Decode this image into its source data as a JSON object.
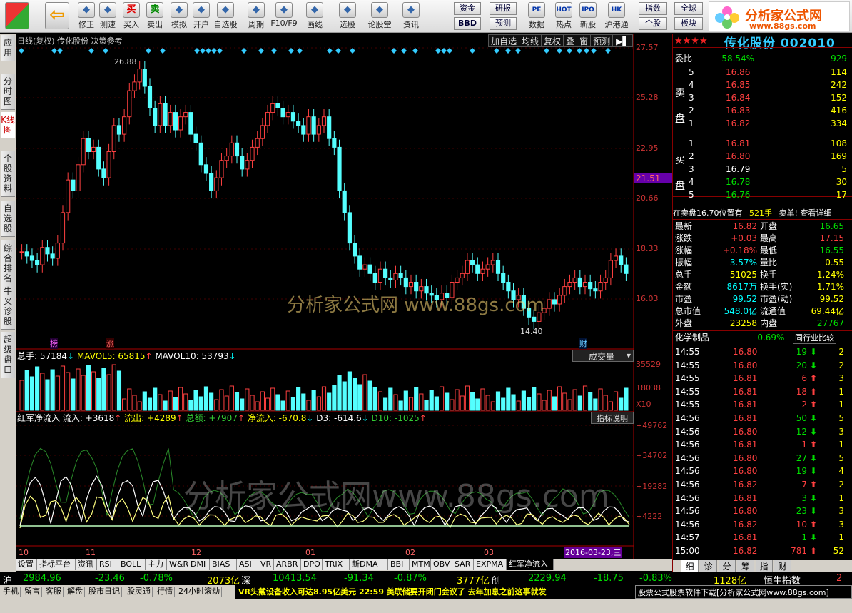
{
  "toolbar": {
    "items": [
      {
        "label": "",
        "icon": "app-icon"
      },
      {
        "label": "",
        "icon": "back-arrow-icon"
      },
      {
        "label": "修正",
        "icon": "up-icon"
      },
      {
        "label": "测速",
        "icon": "clock-icon"
      },
      {
        "label": "买入",
        "icon": "buy-icon",
        "glyph": "买"
      },
      {
        "label": "卖出",
        "icon": "sell-icon",
        "glyph": "卖"
      },
      {
        "label": "模拟",
        "icon": "hammer-icon"
      },
      {
        "label": "开户",
        "icon": "lock-icon"
      },
      {
        "label": "自选股",
        "icon": "star-icon"
      },
      {
        "label": "周期",
        "icon": "cycle-icon"
      },
      {
        "label": "F10/F9",
        "icon": "f10-icon"
      },
      {
        "label": "画线",
        "icon": "pencil-icon"
      },
      {
        "label": "选股",
        "icon": "screen-icon"
      },
      {
        "label": "论股堂",
        "icon": "forum-icon"
      },
      {
        "label": "资讯",
        "icon": "news-icon"
      }
    ],
    "group_buttons": [
      "资金",
      "研报",
      "BBD",
      "预测"
    ],
    "right_items": [
      {
        "label": "数据",
        "glyph": "PE"
      },
      {
        "label": "热点",
        "glyph": "HOT"
      },
      {
        "label": "新股",
        "glyph": "IPO"
      },
      {
        "label": "沪港通",
        "glyph": "HK"
      }
    ],
    "right_buttons": [
      "指数",
      "全球",
      "个股",
      "板块"
    ],
    "logo_text": "分析家公式网",
    "logo_url": "www.88gs.com"
  },
  "vtabs": [
    "应用",
    "分时图",
    "K线图",
    "个股资料",
    "自选股",
    "综合排名",
    "牛叉诊股",
    "超级盘口"
  ],
  "chart": {
    "title": "日线(复权)  传化股份  决策参考",
    "tools": [
      "加自选",
      "均线",
      "复权",
      "叠",
      "窗",
      "预测"
    ],
    "price_axis": [
      "27.57",
      "25.28",
      "22.95",
      "20.66",
      "18.33",
      "16.03"
    ],
    "current_price_tag": "21.51",
    "high_label": "26.88",
    "low_label": "14.40",
    "marker1": "榜",
    "marker2": "涨",
    "marker3": "财",
    "volume_header": "总手: 57184",
    "vol_mavol5": "MAVOL5: 65815",
    "vol_mavol10": "MAVOL10: 53793",
    "volume_dropdown": "成交量",
    "volume_axis": [
      "35529",
      "18038",
      "X10"
    ],
    "ind_name": "红军净流入",
    "ind_inflow": "流入: +3618",
    "ind_outflow": "流出: +4289",
    "ind_total": "总额: +7907",
    "ind_net": "净流入: -670.8",
    "ind_d3": "D3: -614.6",
    "ind_d10": "D10: -1025",
    "ind_help": "指标说明",
    "ind_axis": [
      "+49762",
      "+34702",
      "+19282",
      "+4222"
    ],
    "months": [
      "10",
      "11",
      "12",
      "01",
      "02",
      "03"
    ],
    "cursor_date": "2016-03-23,三",
    "watermark1": "分析家公式网 www.88gs.com",
    "watermark2": "分析家公式网www.88gs.com"
  },
  "bottom_tabs": [
    "设置",
    "指标平台",
    "资讯",
    "RSI",
    "BOLL",
    "主力",
    "W&R",
    "DMI",
    "BIAS",
    "ASI",
    "VR",
    "ARBR",
    "DPO",
    "TRIX",
    "新DMA",
    "BBI",
    "MTM",
    "OBV",
    "SAR",
    "EXPMA",
    "红军净流入"
  ],
  "quote": {
    "stock_name": "传化股份 002010",
    "wb_label": "委比",
    "wb_value": "-58.54%",
    "wb_diff": "-929",
    "sell_side": "卖盘",
    "buy_side": "买盘",
    "sell": [
      {
        "lv": "5",
        "price": "16.86",
        "vol": "114"
      },
      {
        "lv": "4",
        "price": "16.85",
        "vol": "242"
      },
      {
        "lv": "3",
        "price": "16.84",
        "vol": "152"
      },
      {
        "lv": "2",
        "price": "16.83",
        "vol": "416"
      },
      {
        "lv": "1",
        "price": "16.82",
        "vol": "334"
      }
    ],
    "buy": [
      {
        "lv": "1",
        "price": "16.81",
        "vol": "108"
      },
      {
        "lv": "2",
        "price": "16.80",
        "vol": "169"
      },
      {
        "lv": "3",
        "price": "16.79",
        "vol": "5"
      },
      {
        "lv": "4",
        "price": "16.78",
        "vol": "30"
      },
      {
        "lv": "5",
        "price": "16.76",
        "vol": "17"
      }
    ],
    "notice": "在卖盘16.70位置有",
    "notice_qty": "521手",
    "notice_tail": "卖单! 查看详细",
    "stats": [
      [
        "最新",
        "16.82",
        "开盘",
        "16.65"
      ],
      [
        "涨跌",
        "+0.03",
        "最高",
        "17.15"
      ],
      [
        "涨幅",
        "+0.18%",
        "最低",
        "16.55"
      ],
      [
        "振幅",
        "3.57%",
        "量比",
        "0.55"
      ],
      [
        "总手",
        "51025",
        "换手",
        "1.24%"
      ],
      [
        "金额",
        "8617万",
        "换手(实)",
        "1.71%"
      ],
      [
        "市盈",
        "99.52",
        "市盈(动)",
        "99.52"
      ],
      [
        "总市值",
        "548.0亿",
        "流通值",
        "69.44亿"
      ],
      [
        "外盘",
        "23258",
        "内盘",
        "27767"
      ]
    ],
    "industry": "化学制品",
    "industry_pct": "-0.69%",
    "industry_btn": "同行业比较",
    "ticks": [
      [
        "14:55",
        "16.80",
        "19",
        "2",
        "d"
      ],
      [
        "14:55",
        "16.80",
        "20",
        "2",
        "d"
      ],
      [
        "14:55",
        "16.81",
        "6",
        "3",
        "u"
      ],
      [
        "14:55",
        "16.81",
        "18",
        "1",
        "u"
      ],
      [
        "14:55",
        "16.81",
        "2",
        "1",
        "u"
      ],
      [
        "14:56",
        "16.81",
        "50",
        "5",
        "d"
      ],
      [
        "14:56",
        "16.80",
        "12",
        "3",
        "d"
      ],
      [
        "14:56",
        "16.81",
        "1",
        "1",
        "u"
      ],
      [
        "14:56",
        "16.80",
        "27",
        "5",
        "d"
      ],
      [
        "14:56",
        "16.80",
        "19",
        "4",
        "d"
      ],
      [
        "14:56",
        "16.82",
        "7",
        "2",
        "u"
      ],
      [
        "14:56",
        "16.81",
        "3",
        "1",
        "d"
      ],
      [
        "14:56",
        "16.80",
        "23",
        "3",
        "d"
      ],
      [
        "14:56",
        "16.82",
        "10",
        "3",
        "u"
      ],
      [
        "14:57",
        "16.81",
        "1",
        "1",
        "d"
      ],
      [
        "15:00",
        "16.82",
        "781",
        "52",
        "u"
      ]
    ],
    "right_tabs": [
      "细",
      "诊",
      "分",
      "筹",
      "指",
      "财"
    ]
  },
  "index_bar": {
    "sh_label": "沪",
    "sh_value": "2984.96",
    "sh_chg": "-23.46",
    "sh_pct": "-0.78%",
    "sh_amt": "2073亿",
    "sz_label": "深",
    "sz_value": "10413.54",
    "sz_chg": "-91.34",
    "sz_pct": "-0.87%",
    "sz_amt": "3777亿",
    "cy_label": "创",
    "cy_value": "2229.94",
    "cy_chg": "-18.75",
    "cy_pct": "-0.83%",
    "cy_amt": "1128亿",
    "hs_label": "恒生指数",
    "hs_value": "2"
  },
  "status_bar": {
    "items": [
      "手机",
      "留言",
      "客服",
      "解盘",
      "股市日记",
      "股灵通",
      "行情",
      "24小时滚动"
    ],
    "ticker": "VR头戴设备收入可达8.95亿美元      22:59 美联储要开闭门会议了 去年加息之前这事就发",
    "ad": "股票公式股票软件下载[分析家公式网www.88gs.com]"
  }
}
